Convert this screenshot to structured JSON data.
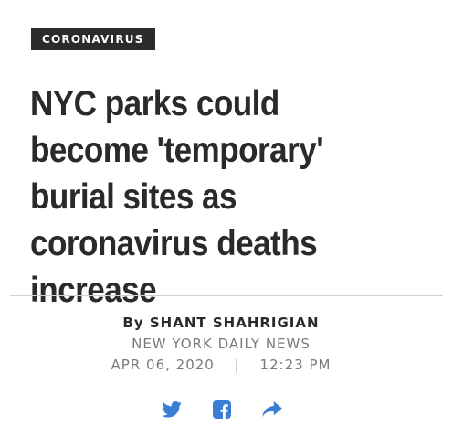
{
  "article": {
    "section_label": "CORONAVIRUS",
    "headline": "NYC parks could become 'temporary' burial sites as coronavirus deaths increase",
    "byline_prefix": "By",
    "author": "SHANT SHAHRIGIAN",
    "source": "NEW YORK DAILY NEWS",
    "date": "APR 06, 2020",
    "separator": "|",
    "time": "12:23 PM"
  },
  "share": {
    "buttons": [
      {
        "icon": "twitter-icon"
      },
      {
        "icon": "facebook-icon"
      },
      {
        "icon": "share-arrow-icon"
      }
    ],
    "icon_color": "#3b7fd4"
  },
  "colors": {
    "badge_background": "#2b2b2b",
    "headline": "#2a2a2a",
    "meta_gray": "#7a7a7a"
  }
}
